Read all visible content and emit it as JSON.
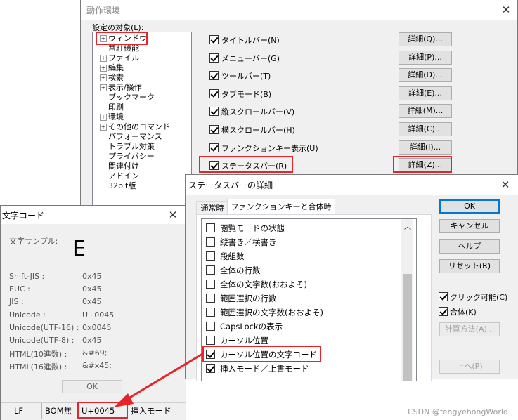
{
  "main_dialog": {
    "title": "動作環境",
    "target_label": "設定の対象(L):",
    "tree": [
      {
        "label": "ウィンドウ",
        "expander": true
      },
      {
        "label": "常駐機能",
        "expander": false
      },
      {
        "label": "ファイル",
        "expander": true
      },
      {
        "label": "編集",
        "expander": true
      },
      {
        "label": "検索",
        "expander": true
      },
      {
        "label": "表示/操作",
        "expander": true
      },
      {
        "label": "ブックマーク",
        "expander": false
      },
      {
        "label": "印刷",
        "expander": false
      },
      {
        "label": "環境",
        "expander": true
      },
      {
        "label": "その他のコマンド",
        "expander": true
      },
      {
        "label": "パフォーマンス",
        "expander": false
      },
      {
        "label": "トラブル対策",
        "expander": false
      },
      {
        "label": "プライバシー",
        "expander": false
      },
      {
        "label": "関連付け",
        "expander": false
      },
      {
        "label": "アドイン",
        "expander": false
      },
      {
        "label": "32bit版",
        "expander": false
      }
    ],
    "options": [
      {
        "label": "タイトルバー(N)",
        "detail": "詳細(Q)..."
      },
      {
        "label": "メニューバー(G)",
        "detail": "詳細(P)..."
      },
      {
        "label": "ツールバー(T)",
        "detail": "詳細(D)..."
      },
      {
        "label": "タブモード(B)",
        "detail": "詳細(E)..."
      },
      {
        "label": "縦スクロールバー(V)",
        "detail": "詳細(M)..."
      },
      {
        "label": "横スクロールバー(H)",
        "detail": "詳細(C)..."
      },
      {
        "label": "ファンクションキー表示(U)",
        "detail": "詳細(I)..."
      },
      {
        "label": "ステータスバー(R)",
        "detail": "詳細(Z)..."
      }
    ]
  },
  "statusbar_dialog": {
    "title": "ステータスバーの詳細",
    "tabs": [
      "通常時",
      "ファンクションキーと合体時"
    ],
    "items": [
      {
        "label": "閲覧モードの状態",
        "checked": false
      },
      {
        "label": "縦書き／横書き",
        "checked": false
      },
      {
        "label": "段組数",
        "checked": false
      },
      {
        "label": "全体の行数",
        "checked": false
      },
      {
        "label": "全体の文字数(おおよそ)",
        "checked": false
      },
      {
        "label": "範囲選択の行数",
        "checked": false
      },
      {
        "label": "範囲選択の文字数(おおよそ)",
        "checked": false
      },
      {
        "label": "CapsLockの表示",
        "checked": false
      },
      {
        "label": "カーソル位置",
        "checked": false
      },
      {
        "label": "カーソル位置の文字コード",
        "checked": true
      },
      {
        "label": "挿入モード／上書モード",
        "checked": true
      }
    ],
    "ok": "OK",
    "cancel": "キャンセル",
    "help": "ヘルプ",
    "reset": "リセット(R)",
    "clickable": "クリック可能(C)",
    "combine": "合体(K)",
    "calc": "計算方法(A)...",
    "up": "上へ(P)"
  },
  "charcode_dialog": {
    "title": "文字コード",
    "sample_label": "文字サンプル:",
    "sample_char": "E",
    "rows": [
      {
        "k": "Shift-JIS :",
        "v": "0x45"
      },
      {
        "k": "EUC :",
        "v": "0x45"
      },
      {
        "k": "JIS :",
        "v": "0x45"
      },
      {
        "k": "Unicode :",
        "v": "U+0045"
      },
      {
        "k": "Unicode(UTF-16) :",
        "v": "0x0045"
      },
      {
        "k": "Unicode(UTF-8) :",
        "v": "0x45"
      },
      {
        "k": "HTML(10進数) :",
        "v": "&#69;"
      },
      {
        "k": "HTML(16進数) :",
        "v": "&#x45;"
      }
    ],
    "ok": "OK"
  },
  "statusbar": [
    "LF",
    "BOM無",
    "U+0045",
    "挿入モード"
  ],
  "watermark": "CSDN @fengyehongWorld",
  "colors": {
    "highlight": "#e8242b",
    "arrow": "#e8242b"
  }
}
